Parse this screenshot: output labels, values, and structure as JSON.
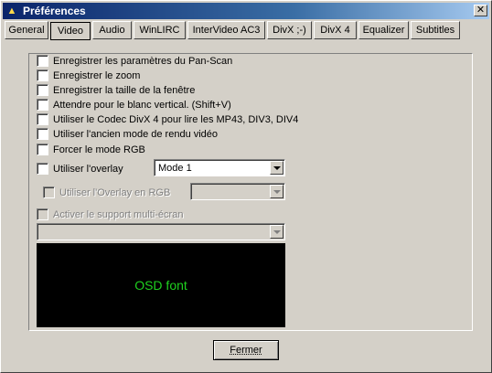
{
  "window": {
    "title": "Préférences",
    "close_glyph": "✕"
  },
  "tabs": [
    {
      "label": "General",
      "active": false
    },
    {
      "label": "Video",
      "active": true
    },
    {
      "label": "Audio",
      "active": false
    },
    {
      "label": "WinLIRC",
      "active": false
    },
    {
      "label": "InterVideo AC3",
      "active": false
    },
    {
      "label": "DivX ;-)",
      "active": false
    },
    {
      "label": "DivX 4",
      "active": false
    },
    {
      "label": "Equalizer",
      "active": false
    },
    {
      "label": "Subtitles",
      "active": false
    }
  ],
  "options": [
    {
      "label": "Enregistrer les paramètres du Pan-Scan",
      "checked": false,
      "enabled": true
    },
    {
      "label": "Enregistrer le zoom",
      "checked": false,
      "enabled": true
    },
    {
      "label": "Enregistrer la taille de la fenêtre",
      "checked": false,
      "enabled": true
    },
    {
      "label": "Attendre pour le blanc vertical. (Shift+V)",
      "checked": false,
      "enabled": true
    },
    {
      "label": "Utiliser le Codec DivX 4 pour lire les MP43, DIV3, DIV4",
      "checked": false,
      "enabled": true
    },
    {
      "label": "Utiliser l'ancien mode de rendu vidéo",
      "checked": false,
      "enabled": true
    },
    {
      "label": "Forcer le mode RGB",
      "checked": false,
      "enabled": true
    }
  ],
  "overlay": {
    "label": "Utiliser l'overlay",
    "checked": false,
    "mode_value": "Mode 1"
  },
  "overlay_rgb": {
    "label": "Utiliser l'Overlay en RGB",
    "enabled": false,
    "value": ""
  },
  "multiscreen": {
    "label": "Activer le support multi-écran",
    "enabled": false,
    "value": ""
  },
  "osd": {
    "text": "OSD font",
    "background": "#000000",
    "color": "#1fd11f"
  },
  "footer": {
    "close_label": "Fermer"
  }
}
